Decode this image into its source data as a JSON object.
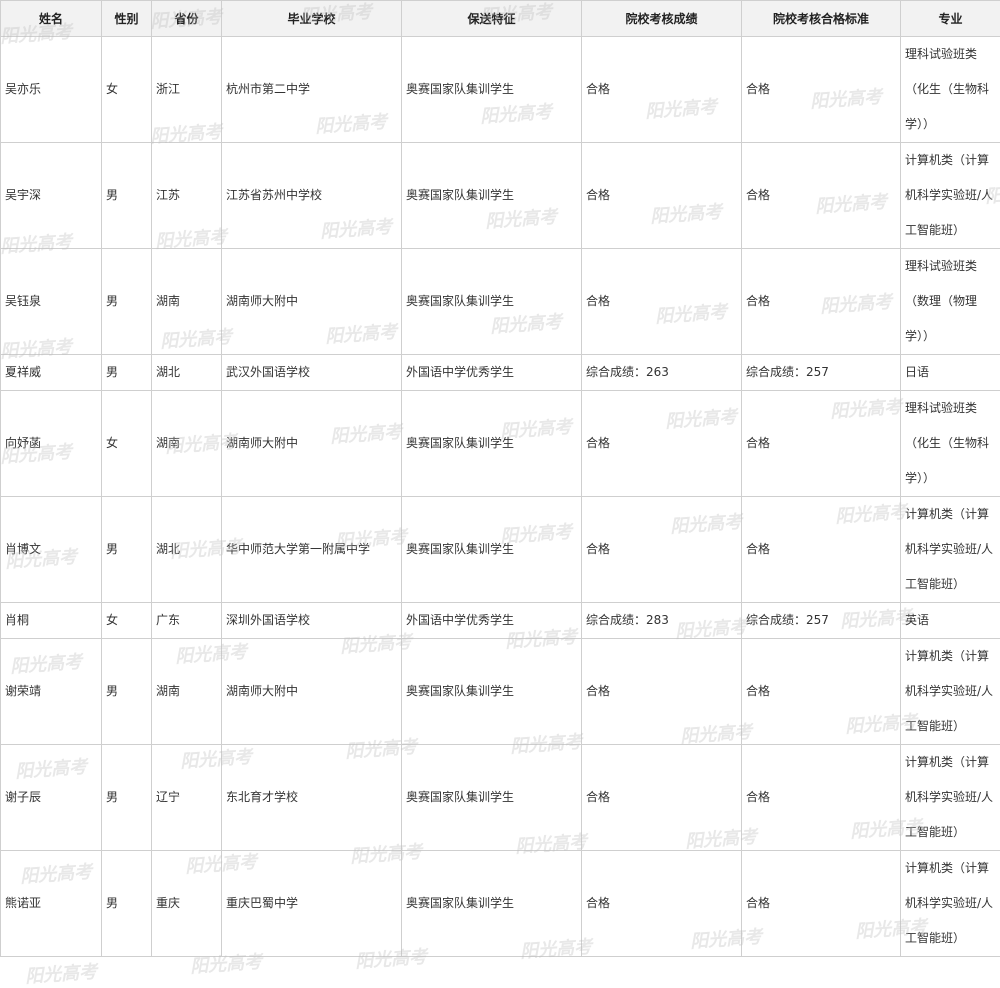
{
  "headers": [
    "姓名",
    "性别",
    "省份",
    "毕业学校",
    "保送特征",
    "院校考核成绩",
    "院校考核合格标准",
    "专业"
  ],
  "rows": [
    {
      "name": "吴亦乐",
      "gender": "女",
      "province": "浙江",
      "school": "杭州市第二中学",
      "feature": "奥赛国家队集训学生",
      "score": "合格",
      "standard": "合格",
      "major": "理科试验班类（化生（生物科学））"
    },
    {
      "name": "吴宇深",
      "gender": "男",
      "province": "江苏",
      "school": "江苏省苏州中学校",
      "feature": "奥赛国家队集训学生",
      "score": "合格",
      "standard": "合格",
      "major": "计算机类（计算机科学实验班/人工智能班）"
    },
    {
      "name": "吴钰泉",
      "gender": "男",
      "province": "湖南",
      "school": "湖南师大附中",
      "feature": "奥赛国家队集训学生",
      "score": "合格",
      "standard": "合格",
      "major": "理科试验班类（数理（物理学））"
    },
    {
      "name": "夏祥威",
      "gender": "男",
      "province": "湖北",
      "school": "武汉外国语学校",
      "feature": "外国语中学优秀学生",
      "score": "综合成绩：263",
      "standard": "综合成绩：257",
      "major": "日语"
    },
    {
      "name": "向妤菡",
      "gender": "女",
      "province": "湖南",
      "school": "湖南师大附中",
      "feature": "奥赛国家队集训学生",
      "score": "合格",
      "standard": "合格",
      "major": "理科试验班类（化生（生物科学））"
    },
    {
      "name": "肖博文",
      "gender": "男",
      "province": "湖北",
      "school": "华中师范大学第一附属中学",
      "feature": "奥赛国家队集训学生",
      "score": "合格",
      "standard": "合格",
      "major": "计算机类（计算机科学实验班/人工智能班）"
    },
    {
      "name": "肖桐",
      "gender": "女",
      "province": "广东",
      "school": "深圳外国语学校",
      "feature": "外国语中学优秀学生",
      "score": "综合成绩：283",
      "standard": "综合成绩：257",
      "major": "英语"
    },
    {
      "name": "谢荣靖",
      "gender": "男",
      "province": "湖南",
      "school": "湖南师大附中",
      "feature": "奥赛国家队集训学生",
      "score": "合格",
      "standard": "合格",
      "major": "计算机类（计算机科学实验班/人工智能班）"
    },
    {
      "name": "谢子辰",
      "gender": "男",
      "province": "辽宁",
      "school": "东北育才学校",
      "feature": "奥赛国家队集训学生",
      "score": "合格",
      "standard": "合格",
      "major": "计算机类（计算机科学实验班/人工智能班）"
    },
    {
      "name": "熊诺亚",
      "gender": "男",
      "province": "重庆",
      "school": "重庆巴蜀中学",
      "feature": "奥赛国家队集训学生",
      "score": "合格",
      "standard": "合格",
      "major": "计算机类（计算机科学实验班/人工智能班）"
    }
  ],
  "watermark": "阳光高考"
}
